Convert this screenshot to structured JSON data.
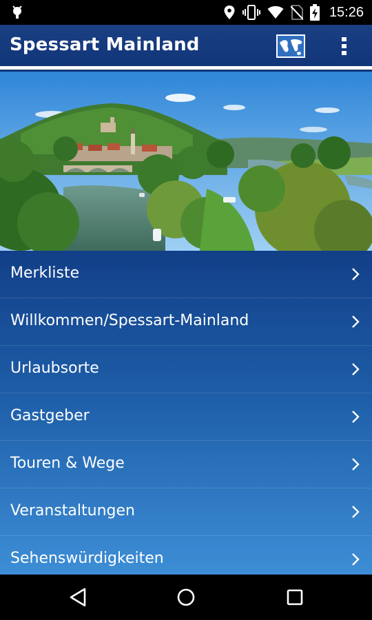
{
  "status_bar": {
    "time": "15:26",
    "icons": [
      "android-debug-icon",
      "location-icon",
      "vibrate-icon",
      "wifi-icon",
      "no-sim-icon",
      "battery-charging-icon"
    ]
  },
  "app_bar": {
    "title": "Spessart Mainland",
    "actions": [
      "map-icon",
      "overflow-menu-icon"
    ]
  },
  "hero": {
    "subject": "river-valley-landscape"
  },
  "menu": {
    "items": [
      {
        "label": "Merkliste"
      },
      {
        "label": "Willkommen/Spessart-Mainland"
      },
      {
        "label": "Urlaubsorte"
      },
      {
        "label": "Gastgeber"
      },
      {
        "label": "Touren & Wege"
      },
      {
        "label": "Veranstaltungen"
      },
      {
        "label": "Sehenswürdigkeiten"
      }
    ]
  },
  "nav_bar": {
    "buttons": [
      "back-icon",
      "home-icon",
      "recents-icon"
    ]
  },
  "colors": {
    "app_bar": "#163b7e",
    "menu_top": "#123f88",
    "menu_bottom": "#3d8ed6"
  }
}
